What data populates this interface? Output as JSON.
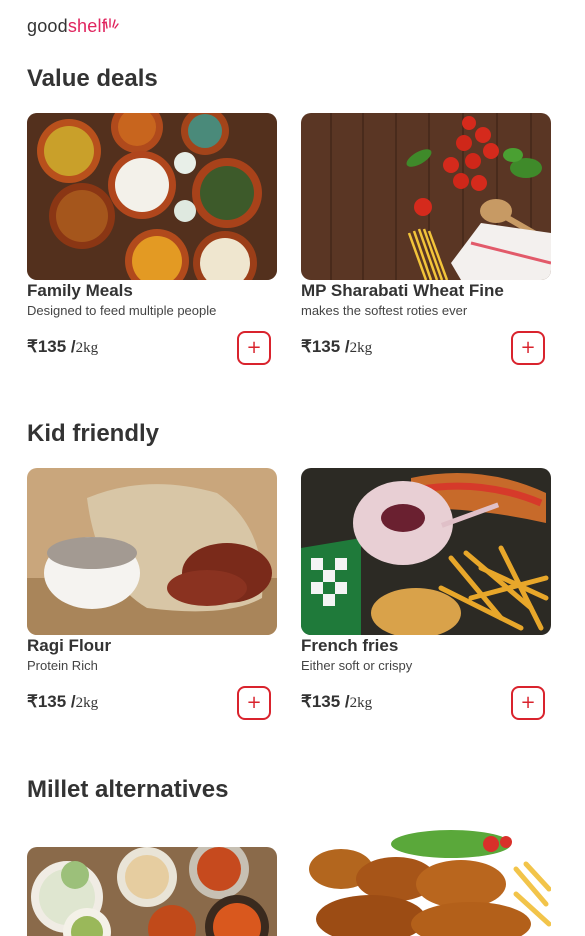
{
  "brand": {
    "part1": "good",
    "part2": "shelf"
  },
  "sections": [
    {
      "title": "Value deals",
      "items": [
        {
          "name": "Family Meals",
          "desc": "Designed to feed multiple people",
          "price": "₹135 /",
          "unit": "2kg",
          "add_label": "+"
        },
        {
          "name": "MP Sharabati Wheat Fine",
          "desc": "makes the softest roties ever",
          "price": "₹135 /",
          "unit": "2kg",
          "add_label": "+"
        }
      ]
    },
    {
      "title": "Kid friendly",
      "items": [
        {
          "name": "Ragi Flour",
          "desc": "Protein Rich",
          "price": "₹135 /",
          "unit": "2kg",
          "add_label": "+"
        },
        {
          "name": "French fries",
          "desc": "Either soft or crispy",
          "price": "₹135 /",
          "unit": "2kg",
          "add_label": "+"
        }
      ]
    },
    {
      "title": "Millet alternatives",
      "items": []
    }
  ],
  "colors": {
    "accent": "#d9232d",
    "brand_pink": "#e0245e",
    "text": "#333333"
  }
}
